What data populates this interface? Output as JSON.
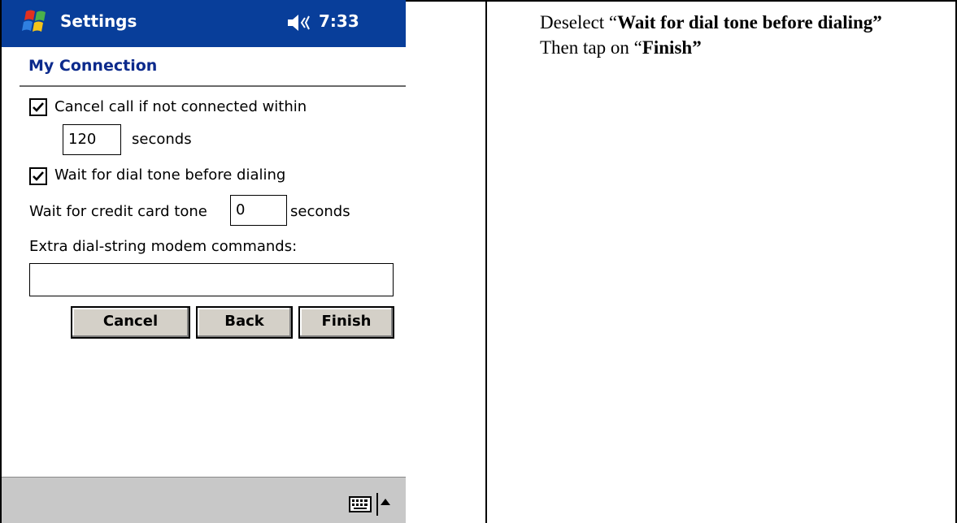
{
  "device": {
    "app_title": "Settings",
    "time": "7:33",
    "icons": {
      "start": "windows-start-icon",
      "volume": "speaker-icon",
      "keyboard": "keyboard-icon",
      "input_menu": "up-arrow-icon"
    }
  },
  "screen": {
    "title": "My Connection",
    "cancel_call_label": "Cancel call if not connected within",
    "cancel_call_checked": true,
    "cancel_timeout_value": "120",
    "seconds_label": "seconds",
    "wait_dial_tone_label": "Wait for dial tone before dialing",
    "wait_dial_tone_checked": true,
    "credit_card_label": "Wait for credit card tone",
    "credit_card_value": "0",
    "credit_seconds_label": "seconds",
    "extra_commands_label": "Extra dial-string modem commands:",
    "extra_commands_value": ""
  },
  "buttons": {
    "cancel": "Cancel",
    "back": "Back",
    "finish": "Finish"
  },
  "instructions": {
    "line1_prefix": "Deselect “",
    "line1_bold": "Wait for dial tone before dialing”",
    "line2_prefix": "Then tap on “",
    "line2_bold": "Finish”"
  },
  "colors": {
    "titlebar": "#083e9a",
    "page_title": "#0c2a8c",
    "button_face": "#d4d0c8",
    "bottombar": "#c8c8c8"
  }
}
